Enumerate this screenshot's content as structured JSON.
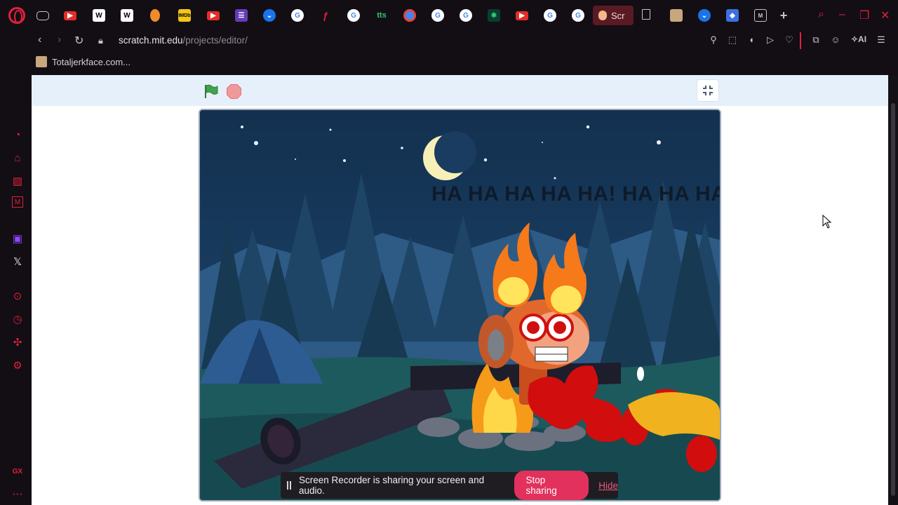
{
  "browser": {
    "active_tab_title": "Scr",
    "url_host": "scratch.mit.edu",
    "url_path": "/projects/editor/",
    "bookmark_label": "Totaljerkface.com...",
    "ai_label": "AI",
    "gx_label": "GX",
    "tab_favicons": [
      "gamepad",
      "youtube",
      "wikipedia",
      "wikipedia",
      "figma",
      "imdb",
      "youtube",
      "forms",
      "chevron-down",
      "google",
      "tool",
      "google",
      "tts",
      "chrome",
      "google",
      "google",
      "link",
      "youtube",
      "google",
      "google"
    ],
    "tab_tts_label": "tts",
    "accent_color": "#e0213b"
  },
  "stage": {
    "speech_text": "HA HA HA HA HA! HA HA HA",
    "green_flag_color": "#3fa34d",
    "stop_color": "#ef9a9a"
  },
  "recorder": {
    "message": "Screen Recorder is sharing your screen and audio.",
    "stop_label": "Stop sharing",
    "hide_label": "Hide"
  }
}
